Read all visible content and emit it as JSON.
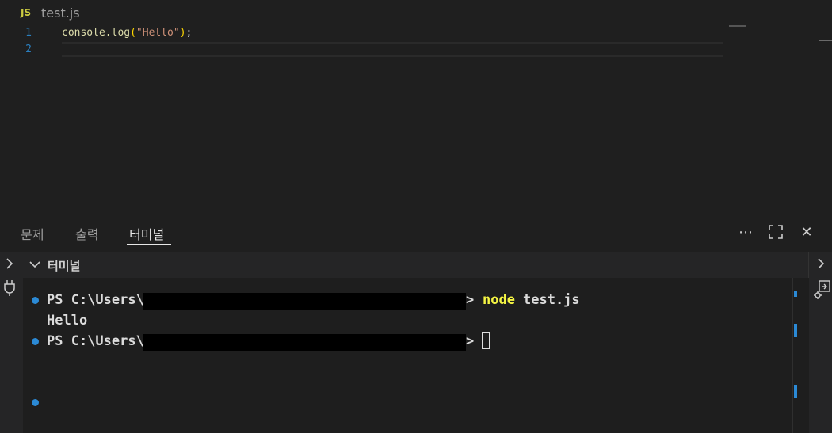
{
  "editor": {
    "tab": {
      "badge": "JS",
      "filename": "test.js"
    },
    "lines": [
      {
        "number": "1",
        "fn": "console.log",
        "open": "(",
        "string": "\"Hello\"",
        "close": ")",
        "end": ";"
      },
      {
        "number": "2"
      }
    ]
  },
  "panel": {
    "tabs": [
      {
        "label": "문제"
      },
      {
        "label": "출력"
      },
      {
        "label": "터미널",
        "active": true
      }
    ],
    "more_label": "⋯",
    "close_label": "✕",
    "section_title": "터미널",
    "terminal": {
      "prompt1": "PS C:\\Users\\",
      "gt": ">",
      "command": "node",
      "argument": "test.js",
      "output": "Hello",
      "prompt2": "PS C:\\Users\\"
    }
  },
  "colors": {
    "accent": "#2b8ad6",
    "command": "#f5f543",
    "js_badge": "#cbcb41",
    "line_number": "#2a7fbf"
  },
  "icons": [
    "chevron-right-icon",
    "chevron-down-icon",
    "plug-icon",
    "maximize-icon",
    "more-icon",
    "close-icon",
    "move-panel-icon"
  ]
}
